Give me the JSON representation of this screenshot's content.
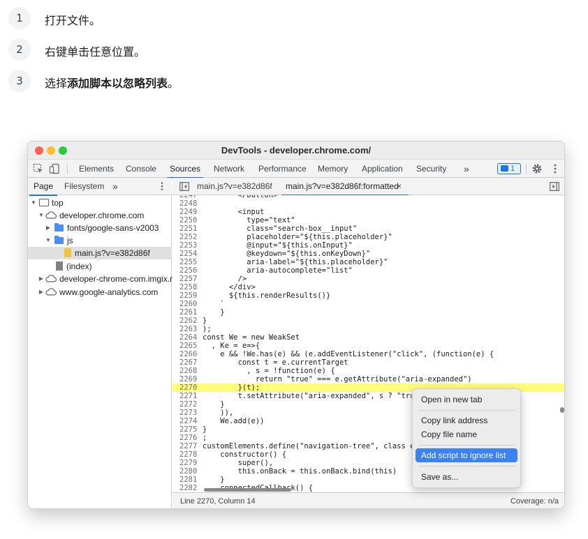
{
  "steps": [
    {
      "num": "1",
      "text": "打开文件。"
    },
    {
      "num": "2",
      "text": "右键单击任意位置。"
    },
    {
      "num": "3",
      "text_prefix": "选择",
      "text_bold": "添加脚本以忽略列表",
      "text_suffix": "。"
    }
  ],
  "window": {
    "title": "DevTools - developer.chrome.com/",
    "tabs": [
      "Elements",
      "Console",
      "Sources",
      "Network",
      "Performance",
      "Memory",
      "Application",
      "Security"
    ],
    "active_tab": "Sources",
    "more": "»",
    "issues_count": "1",
    "settings_icon": "gear-icon",
    "menu_icon": "kebab-icon"
  },
  "navigator": {
    "tabs": [
      "Page",
      "Filesystem"
    ],
    "more": "»",
    "tree": [
      {
        "label": "top",
        "icon": "frame-icon",
        "arrow": "▼"
      },
      {
        "label": "developer.chrome.com",
        "icon": "cloud-icon",
        "arrow": "▼"
      },
      {
        "label": "fonts/google-sans-v2003",
        "icon": "folder-icon",
        "arrow": "▶"
      },
      {
        "label": "js",
        "icon": "folder-icon",
        "arrow": "▼"
      },
      {
        "label": "main.js?v=e382d86f",
        "icon": "js-file-icon",
        "arrow": ""
      },
      {
        "label": "(index)",
        "icon": "file-icon",
        "arrow": ""
      },
      {
        "label": "developer-chrome-com.imgix.net",
        "icon": "cloud-icon",
        "arrow": "▶"
      },
      {
        "label": "www.google-analytics.com",
        "icon": "cloud-icon",
        "arrow": "▶"
      }
    ]
  },
  "editor": {
    "tabs": [
      "main.js?v=e382d86f",
      "main.js?v=e382d86f:formatted"
    ],
    "close": "×",
    "lines": [
      {
        "n": "2247",
        "t": "        </button>"
      },
      {
        "n": "2248",
        "t": ""
      },
      {
        "n": "2249",
        "t": "        <input"
      },
      {
        "n": "2250",
        "t": "          type=\"text\""
      },
      {
        "n": "2251",
        "t": "          class=\"search-box__input\""
      },
      {
        "n": "2252",
        "t": "          placeholder=\"${this.placeholder}\""
      },
      {
        "n": "2253",
        "t": "          @input=\"${this.onInput}\""
      },
      {
        "n": "2254",
        "t": "          @keydown=\"${this.onKeyDown}\""
      },
      {
        "n": "2255",
        "t": "          aria-label=\"${this.placeholder}\""
      },
      {
        "n": "2256",
        "t": "          aria-autocomplete=\"list\""
      },
      {
        "n": "2257",
        "t": "        />"
      },
      {
        "n": "2258",
        "t": "      </div>"
      },
      {
        "n": "2259",
        "t": "      ${this.renderResults()}"
      },
      {
        "n": "2260",
        "t": "    `"
      },
      {
        "n": "2261",
        "t": "    }"
      },
      {
        "n": "2262",
        "t": "}"
      },
      {
        "n": "2263",
        "t": ");"
      },
      {
        "n": "2264",
        "t": "const We = new WeakSet"
      },
      {
        "n": "2265",
        "t": "  , Ke = e=>{"
      },
      {
        "n": "2266",
        "t": "    e && !We.has(e) && (e.addEventListener(\"click\", (function(e) {"
      },
      {
        "n": "2267",
        "t": "        const t = e.currentTarget"
      },
      {
        "n": "2268",
        "t": "          , s = !function(e) {"
      },
      {
        "n": "2269",
        "t": "            return \"true\" === e.getAttribute(\"aria-expanded\")"
      },
      {
        "n": "2270",
        "t": "        }(t);"
      },
      {
        "n": "2271",
        "t": "        t.setAttribute(\"aria-expanded\", s ? \"true\""
      },
      {
        "n": "2272",
        "t": "    }"
      },
      {
        "n": "2273",
        "t": "    )),"
      },
      {
        "n": "2274",
        "t": "    We.add(e))"
      },
      {
        "n": "2275",
        "t": "}"
      },
      {
        "n": "2276",
        "t": ";"
      },
      {
        "n": "2277",
        "t": "customElements.define(\"navigation-tree\", class ex"
      },
      {
        "n": "2278",
        "t": "    constructor() {"
      },
      {
        "n": "2279",
        "t": "        super(),"
      },
      {
        "n": "2280",
        "t": "        this.onBack = this.onBack.bind(this)"
      },
      {
        "n": "2281",
        "t": "    }"
      },
      {
        "n": "2282",
        "t": "    connectedCallback() {"
      }
    ],
    "highlight_line": "2270"
  },
  "status": {
    "position": "Line 2270, Column 14",
    "coverage": "Coverage: n/a"
  },
  "context_menu": {
    "items": [
      "Open in new tab",
      "Copy link address",
      "Copy file name",
      "Add script to ignore list",
      "Save as..."
    ],
    "active": "Add script to ignore list"
  }
}
